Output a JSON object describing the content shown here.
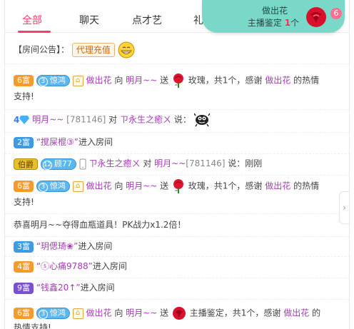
{
  "tabs": [
    {
      "label": "全部",
      "active": true
    },
    {
      "label": "聊天",
      "active": false
    },
    {
      "label": "点才艺",
      "active": false
    },
    {
      "label": "礼",
      "active": false
    }
  ],
  "gift_popup": {
    "gift_name": "做出花",
    "desc_prefix": "主播鉴定",
    "count": "1",
    "unit": "个",
    "badge": "6"
  },
  "notice": {
    "label": "【房间公告】：",
    "tag": "代理充值"
  },
  "messages": {
    "m1": {
      "fu": "6富",
      "level_num": "3",
      "level_name": "惊鸿",
      "from": "做出花",
      "to_word": "向",
      "to": "明月~~",
      "send": "送",
      "gift": "玫瑰，共1个，感谢",
      "thank_user": "做出花",
      "tail": "的热情",
      "wrap": "支持!"
    },
    "m2": {
      "diamond_level": "4",
      "user": "明月~~",
      "id": "[781146]",
      "to_word": "对",
      "target": "ㄗ永生之癒ㄨ",
      "say": "说："
    },
    "m3": {
      "fu": "2富",
      "user": "“搅屎棍③”",
      "action": "进入房间"
    },
    "m4": {
      "fu": "伯爵",
      "level_num": "12",
      "level_name": "顾77",
      "from": "ㄗ永生之癒ㄨ",
      "to_word": "对",
      "to": "明月~~",
      "id": "[781146]",
      "say": "说：刚刚"
    },
    "m5": {
      "fu": "6富",
      "level_num": "3",
      "level_name": "惊鸿",
      "from": "做出花",
      "to_word": "向",
      "to": "明月~~",
      "send": "送",
      "gift": "玫瑰，共1个，感谢",
      "thank_user": "做出花",
      "tail": "的热情",
      "wrap": "支持!"
    },
    "m6": {
      "text": "恭喜明月~~夺得血瓶道具！PK战力x1.2倍！"
    },
    "m7": {
      "fu": "3富",
      "user": "“玥偲琦❀”",
      "action": "进入房间"
    },
    "m8": {
      "fu": "4富",
      "user": "“ⓢ心痛9788”",
      "action": "进入房间"
    },
    "m9": {
      "fu": "9富",
      "user": "“钱鑫20↑”",
      "action": "进入房间"
    },
    "m10": {
      "fu": "6富",
      "level_num": "3",
      "level_name": "惊鸿",
      "from": "做出花",
      "to_word": "向",
      "to": "明月~~",
      "send": "送",
      "gift": "主播鉴定，共1个，感谢",
      "thank_user": "做出花",
      "tail": "的",
      "wrap": "热情支持!"
    }
  },
  "colors": {
    "accent": "#ff3b6b",
    "popup": "#7ad8c9",
    "username": "#a13fb0",
    "fu_orange": "#f59b2b",
    "fu_blue": "#3c9be6",
    "fu_purple": "#7a4fd3"
  },
  "icons": [
    "rose-icon",
    "grin-emoji-icon",
    "diamond-icon",
    "monster-emoji-icon",
    "phone-icon",
    "user-box-icon",
    "chevron-right-icon"
  ]
}
